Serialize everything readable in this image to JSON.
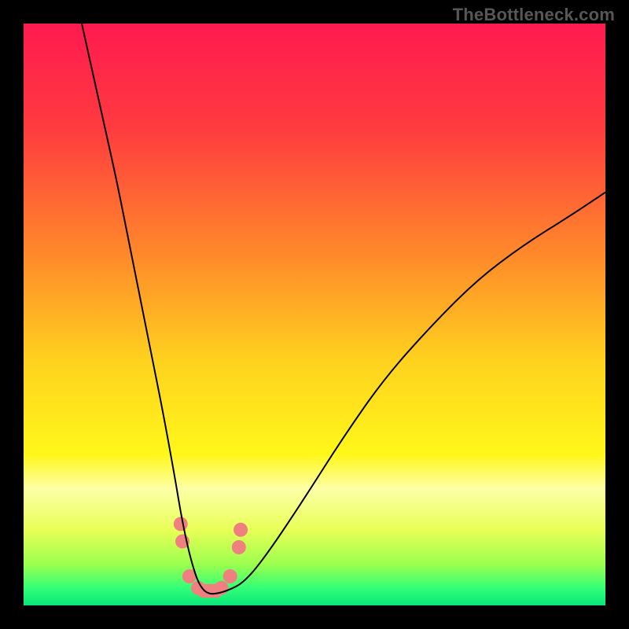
{
  "watermark": "TheBottleneck.com",
  "chart_data": {
    "type": "line",
    "title": "",
    "xlabel": "",
    "ylabel": "",
    "xlim": [
      0,
      100
    ],
    "ylim": [
      0,
      100
    ],
    "grid": false,
    "legend": false,
    "background_gradient": {
      "stops": [
        {
          "pos": 0.0,
          "color": "#ff1a50"
        },
        {
          "pos": 0.18,
          "color": "#ff3b3f"
        },
        {
          "pos": 0.4,
          "color": "#ff8a2a"
        },
        {
          "pos": 0.58,
          "color": "#ffd21e"
        },
        {
          "pos": 0.74,
          "color": "#fff71a"
        },
        {
          "pos": 0.8,
          "color": "#fdffa6"
        },
        {
          "pos": 0.87,
          "color": "#e8ff57"
        },
        {
          "pos": 0.93,
          "color": "#9bff4e"
        },
        {
          "pos": 0.97,
          "color": "#33ff77"
        },
        {
          "pos": 1.0,
          "color": "#09e67a"
        }
      ]
    },
    "series": [
      {
        "name": "bottleneck-curve",
        "color": "#000000",
        "width": 2,
        "x": [
          10,
          12,
          14,
          16,
          18,
          20,
          22,
          24,
          26,
          27,
          28,
          29,
          30,
          31,
          32,
          33,
          35,
          38,
          42,
          48,
          55,
          62,
          70,
          78,
          86,
          94,
          100
        ],
        "y": [
          100,
          91,
          82,
          73,
          63,
          53,
          43,
          33,
          22,
          16,
          11,
          7,
          4,
          2.5,
          2,
          2,
          2.5,
          4,
          9,
          18,
          29,
          39,
          48,
          56,
          62,
          67,
          71
        ]
      }
    ],
    "markers": {
      "name": "highlight-dots",
      "color": "#f08080",
      "radius": 9,
      "points": [
        {
          "x": 27.0,
          "y": 14
        },
        {
          "x": 27.3,
          "y": 11
        },
        {
          "x": 28.5,
          "y": 5
        },
        {
          "x": 30.0,
          "y": 3
        },
        {
          "x": 31.0,
          "y": 2.5
        },
        {
          "x": 32.0,
          "y": 2.5
        },
        {
          "x": 33.0,
          "y": 2.5
        },
        {
          "x": 34.0,
          "y": 3
        },
        {
          "x": 35.5,
          "y": 5
        },
        {
          "x": 37.0,
          "y": 10
        },
        {
          "x": 37.3,
          "y": 13
        }
      ]
    }
  }
}
